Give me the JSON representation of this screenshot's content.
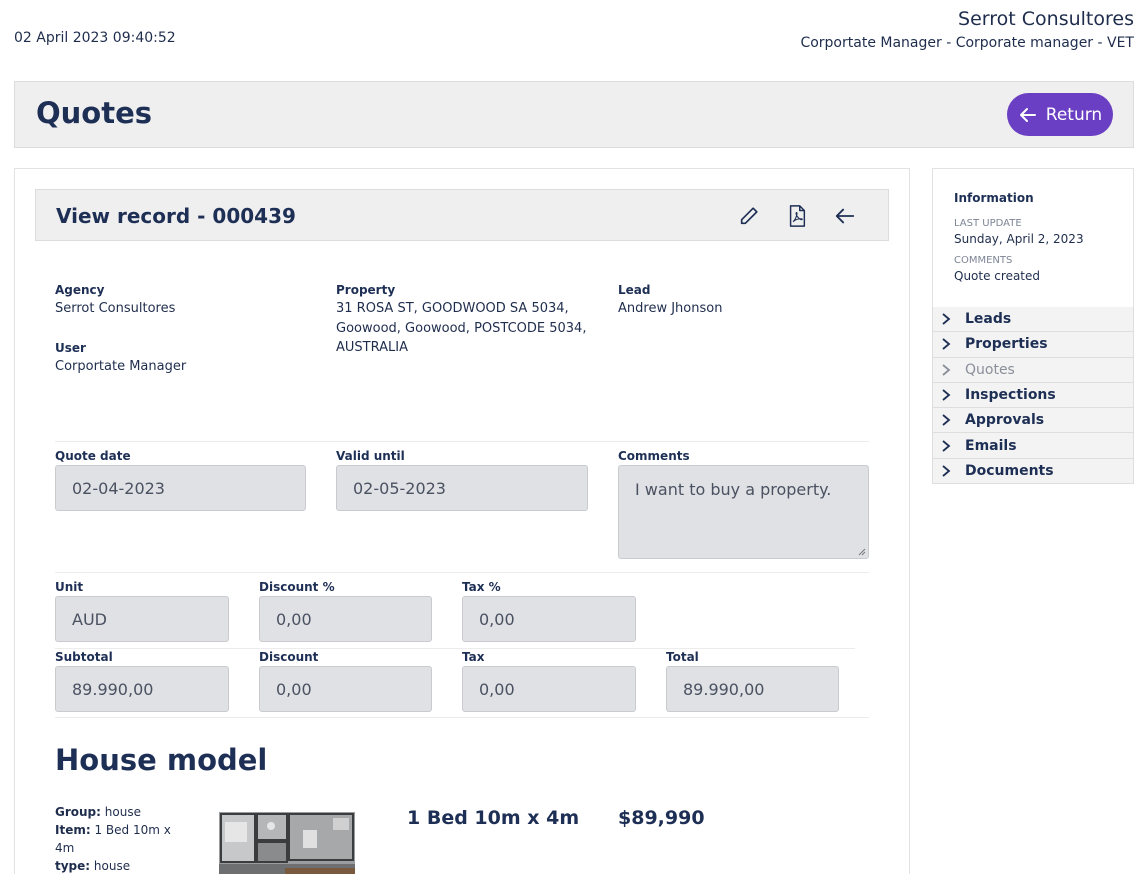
{
  "topbar": {
    "timestamp": "02 April 2023 09:40:52",
    "company": "Serrot Consultores",
    "role": "Corportate Manager - Corporate manager - VET"
  },
  "header": {
    "title": "Quotes",
    "return_label": "Return",
    "accent_color": "#6b3fc4"
  },
  "record": {
    "title": "View record - 000439",
    "icons": [
      "edit-icon",
      "pdf-icon",
      "back-arrow-icon"
    ],
    "agency_label": "Agency",
    "agency": "Serrot Consultores",
    "user_label": "User",
    "user": "Corportate Manager",
    "property_label": "Property",
    "property_line1": "31 ROSA ST, GOODWOOD SA 5034,",
    "property_line2": "Goowood, Goowood, POSTCODE 5034,",
    "property_line3": "AUSTRALIA",
    "lead_label": "Lead",
    "lead": "Andrew Jhonson"
  },
  "quote": {
    "quote_date_label": "Quote date",
    "quote_date": "02-04-2023",
    "valid_until_label": "Valid until",
    "valid_until": "02-05-2023",
    "comments_label": "Comments",
    "comments": "I want to buy a property.",
    "unit_label": "Unit",
    "unit": "AUD",
    "discount_pct_label": "Discount %",
    "discount_pct": "0,00",
    "tax_pct_label": "Tax %",
    "tax_pct": "0,00",
    "subtotal_label": "Subtotal",
    "subtotal": "89.990,00",
    "discount_label": "Discount",
    "discount": "0,00",
    "tax_label": "Tax",
    "tax": "0,00",
    "total_label": "Total",
    "total": "89.990,00"
  },
  "house_model": {
    "section_title": "House model",
    "group_label": "Group:",
    "group": "house",
    "item_label": "Item:",
    "item": "1 Bed 10m x 4m",
    "type_label": "type:",
    "type": "house",
    "name": "1 Bed 10m x 4m",
    "price": "$89,990"
  },
  "info": {
    "title": "Information",
    "last_update_label": "Last update",
    "last_update": "Sunday, April 2, 2023",
    "comments_label": "Comments",
    "comments": "Quote created"
  },
  "sidebar": {
    "items": [
      {
        "label": "Leads",
        "active": true
      },
      {
        "label": "Properties",
        "active": true
      },
      {
        "label": "Quotes",
        "active": false
      },
      {
        "label": "Inspections",
        "active": true
      },
      {
        "label": "Approvals",
        "active": true
      },
      {
        "label": "Emails",
        "active": true
      },
      {
        "label": "Documents",
        "active": true
      }
    ]
  }
}
